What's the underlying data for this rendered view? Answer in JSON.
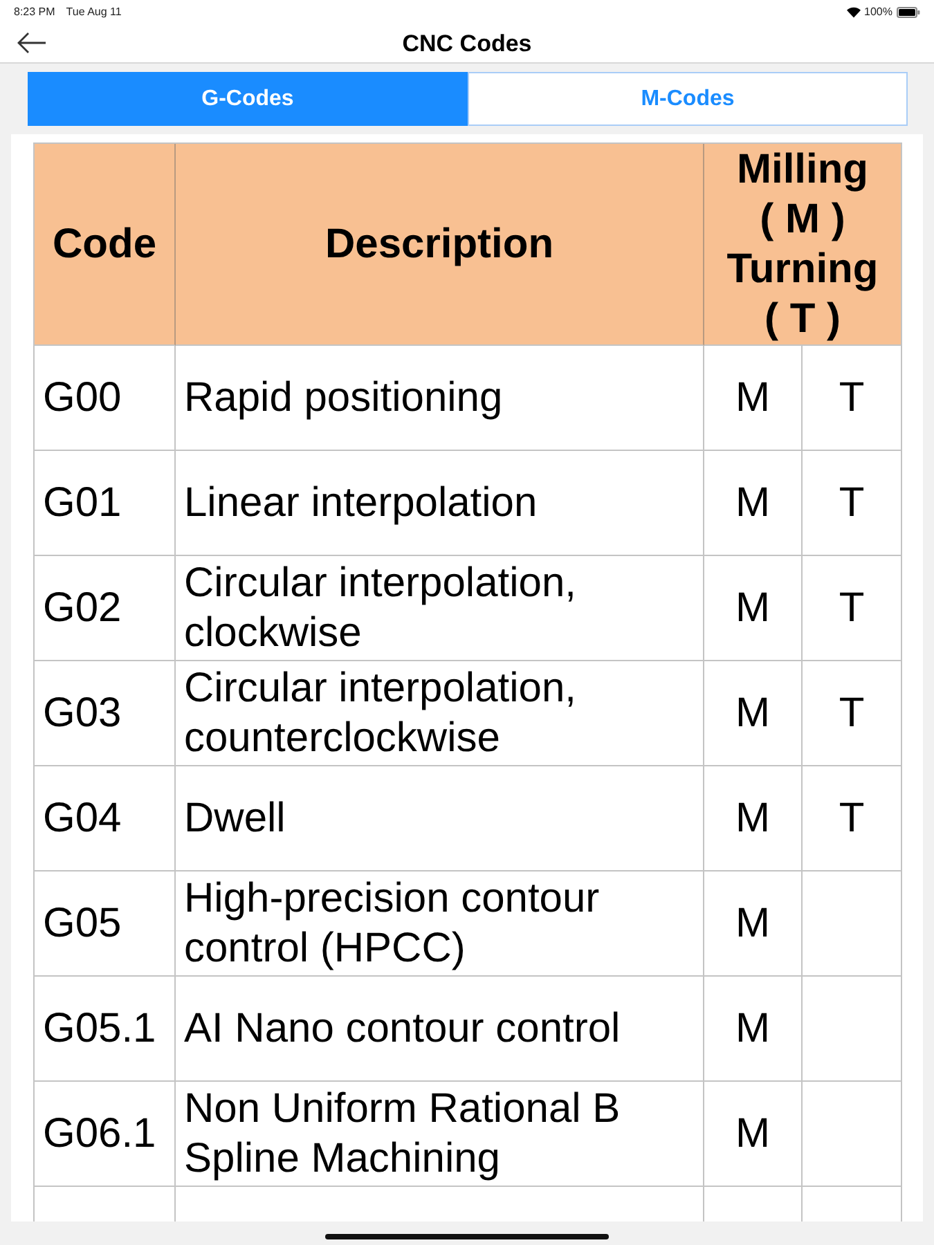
{
  "status_bar": {
    "time": "8:23 PM",
    "date": "Tue Aug 11",
    "battery": "100%"
  },
  "nav": {
    "title": "CNC Codes"
  },
  "tabs": [
    {
      "label": "G-Codes",
      "selected": true
    },
    {
      "label": "M-Codes",
      "selected": false
    }
  ],
  "table": {
    "columns": [
      {
        "kind": "single",
        "label": "Code"
      },
      {
        "kind": "single",
        "label": "Description"
      },
      {
        "kind": "stacked",
        "lines": [
          "Milling",
          "( M )",
          "Turning",
          "( T )"
        ]
      }
    ],
    "rows": [
      {
        "code": "G00",
        "description": "Rapid positioning",
        "milling": "M",
        "turning": "T"
      },
      {
        "code": "G01",
        "description": "Linear interpolation",
        "milling": "M",
        "turning": "T"
      },
      {
        "code": "G02",
        "description": "Circular interpolation, clockwise",
        "milling": "M",
        "turning": "T"
      },
      {
        "code": "G03",
        "description": "Circular interpolation, counterclockwise",
        "milling": "M",
        "turning": "T"
      },
      {
        "code": "G04",
        "description": "Dwell",
        "milling": "M",
        "turning": "T"
      },
      {
        "code": "G05",
        "description": "High-precision contour control (HPCC)",
        "milling": "M"
      },
      {
        "code": "G05.1",
        "description": "AI Nano contour control",
        "milling": "M"
      },
      {
        "code": "G06.1",
        "description": "Non Uniform Rational B Spline Machining",
        "milling": "M"
      }
    ]
  }
}
